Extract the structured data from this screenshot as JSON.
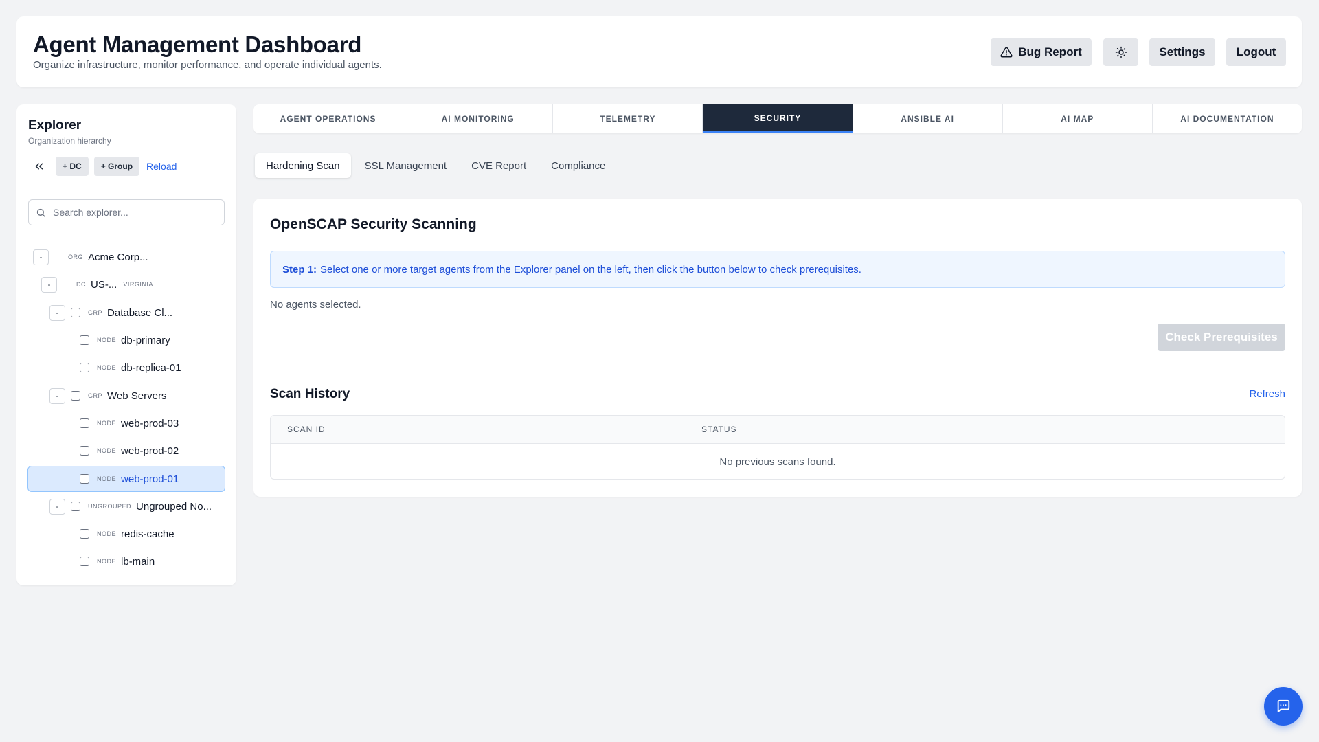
{
  "header": {
    "title": "Agent Management Dashboard",
    "subtitle": "Organize infrastructure, monitor performance, and operate individual agents.",
    "bug_report_label": "Bug Report",
    "theme_icon": "sun-icon",
    "settings_label": "Settings",
    "logout_label": "Logout"
  },
  "explorer": {
    "title": "Explorer",
    "subtitle": "Organization hierarchy",
    "add_dc_label": "+ DC",
    "add_group_label": "+ Group",
    "reload_label": "Reload",
    "search_placeholder": "Search explorer...",
    "tree": {
      "org": {
        "kind": "ORG",
        "label": "Acme Corp...",
        "toggle": "-"
      },
      "dc": {
        "kind": "DC",
        "label": "US-...",
        "region": "VIRGINIA",
        "toggle": "-"
      },
      "group_db": {
        "kind": "GRP",
        "label": "Database Cl...",
        "toggle": "-"
      },
      "db_primary": {
        "kind": "NODE",
        "label": "db-primary"
      },
      "db_replica": {
        "kind": "NODE",
        "label": "db-replica-01"
      },
      "group_web": {
        "kind": "GRP",
        "label": "Web Servers",
        "toggle": "-"
      },
      "web3": {
        "kind": "NODE",
        "label": "web-prod-03"
      },
      "web2": {
        "kind": "NODE",
        "label": "web-prod-02"
      },
      "web1": {
        "kind": "NODE",
        "label": "web-prod-01"
      },
      "ungrouped": {
        "kind": "UNGROUPED",
        "label": "Ungrouped No...",
        "toggle": "-"
      },
      "redis": {
        "kind": "NODE",
        "label": "redis-cache"
      },
      "lb": {
        "kind": "NODE",
        "label": "lb-main"
      }
    }
  },
  "tabs": [
    "AGENT OPERATIONS",
    "AI MONITORING",
    "TELEMETRY",
    "SECURITY",
    "ANSIBLE AI",
    "AI MAP",
    "AI DOCUMENTATION"
  ],
  "active_tab": "SECURITY",
  "subtabs": [
    "Hardening Scan",
    "SSL Management",
    "CVE Report",
    "Compliance"
  ],
  "active_subtab": "Hardening Scan",
  "scan": {
    "title": "OpenSCAP Security Scanning",
    "step_label": "Step 1:",
    "step_text": "Select one or more target agents from the Explorer panel on the left, then click the button below to check prerequisites.",
    "no_agents": "No agents selected.",
    "check_button": "Check Prerequisites",
    "history_title": "Scan History",
    "refresh_label": "Refresh",
    "columns": [
      "SCAN ID",
      "STATUS"
    ],
    "empty_message": "No previous scans found."
  },
  "colors": {
    "accent": "#2563eb",
    "active_tab_bg": "#1e293b",
    "selected_row_bg": "#dbeafe"
  }
}
